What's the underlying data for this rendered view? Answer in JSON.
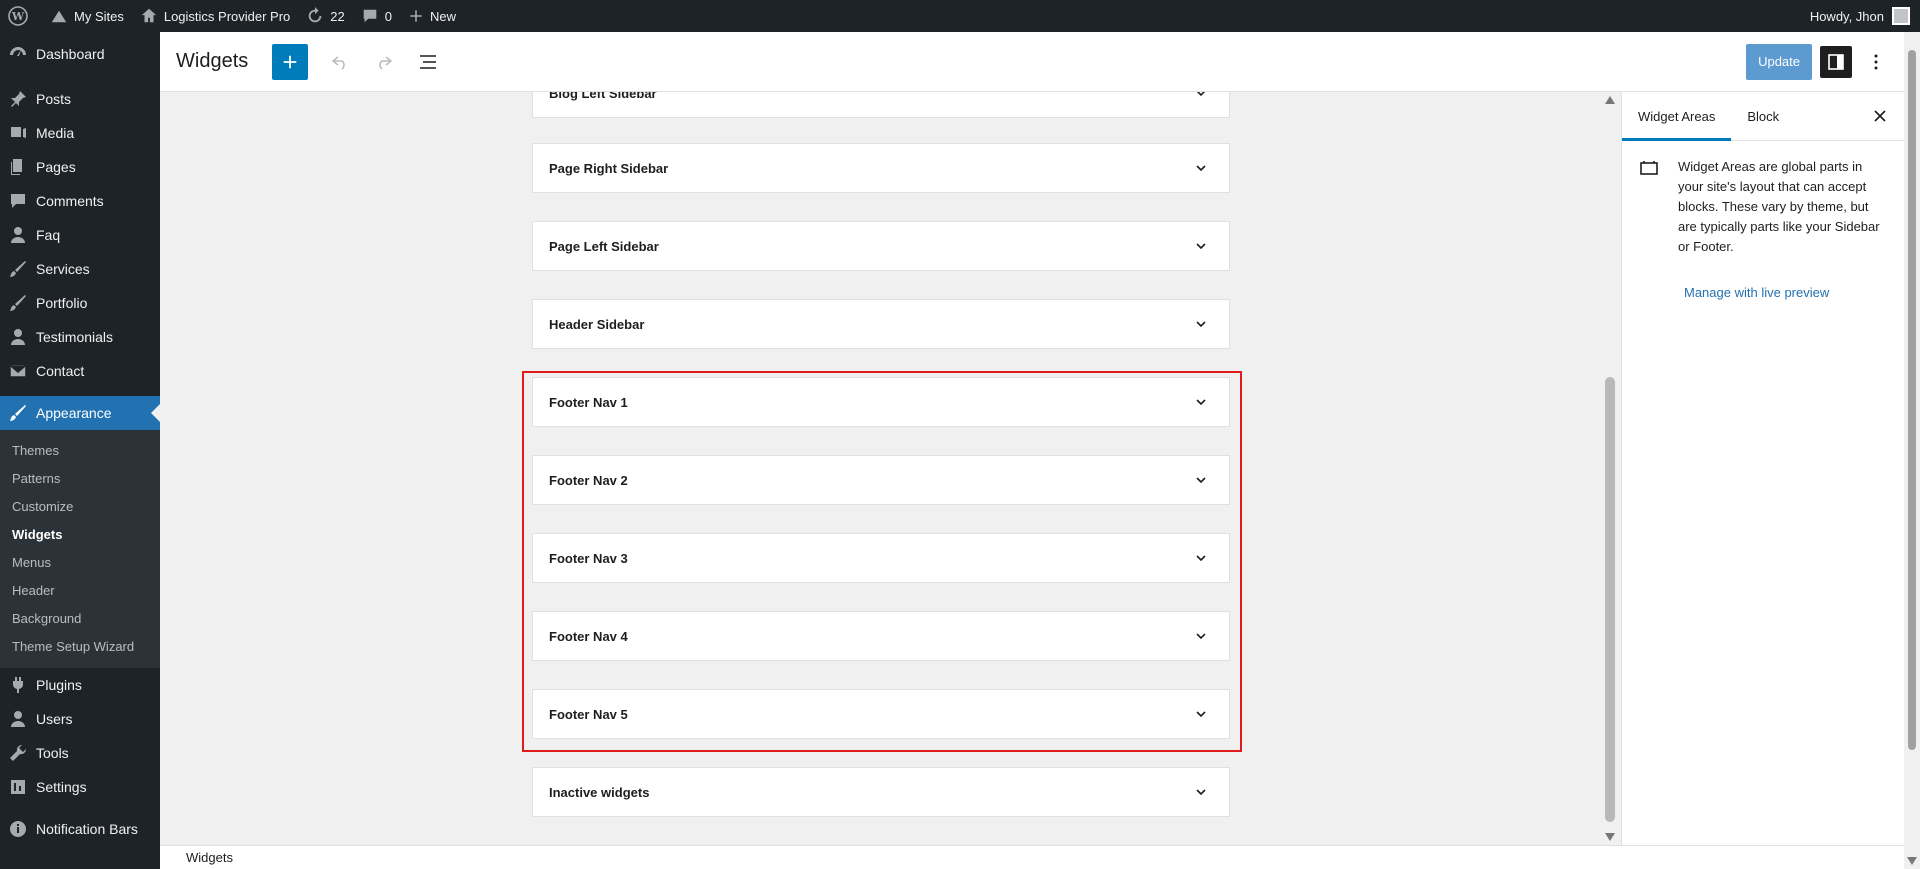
{
  "admin_bar": {
    "my_sites": "My Sites",
    "site_name": "Logistics Provider Pro",
    "updates_count": "22",
    "comments_count": "0",
    "new_label": "New",
    "howdy": "Howdy, Jhon"
  },
  "menu": {
    "dashboard": "Dashboard",
    "posts": "Posts",
    "media": "Media",
    "pages": "Pages",
    "comments": "Comments",
    "faq": "Faq",
    "services": "Services",
    "portfolio": "Portfolio",
    "testimonials": "Testimonials",
    "contact": "Contact",
    "appearance": "Appearance",
    "submenu": [
      "Themes",
      "Patterns",
      "Customize",
      "Widgets",
      "Menus",
      "Header",
      "Background",
      "Theme Setup Wizard"
    ],
    "plugins": "Plugins",
    "users": "Users",
    "tools": "Tools",
    "settings": "Settings",
    "notification_bars": "Notification Bars"
  },
  "editor": {
    "title": "Widgets",
    "update_label": "Update"
  },
  "widget_areas": [
    "Blog Left Sidebar",
    "Page Right Sidebar",
    "Page Left Sidebar",
    "Header Sidebar",
    "Footer Nav 1",
    "Footer Nav 2",
    "Footer Nav 3",
    "Footer Nav 4",
    "Footer Nav 5",
    "Inactive widgets"
  ],
  "sidebar": {
    "tab_widget_areas": "Widget Areas",
    "tab_block": "Block",
    "description": "Widget Areas are global parts in your site's layout that can accept blocks. These vary by theme, but are typically parts like your Sidebar or Footer.",
    "link": "Manage with live preview"
  },
  "footer": {
    "breadcrumb": "Widgets"
  },
  "colors": {
    "accent": "#007cba",
    "highlight": "#e01b1b",
    "admin_bg": "#1d2327"
  }
}
